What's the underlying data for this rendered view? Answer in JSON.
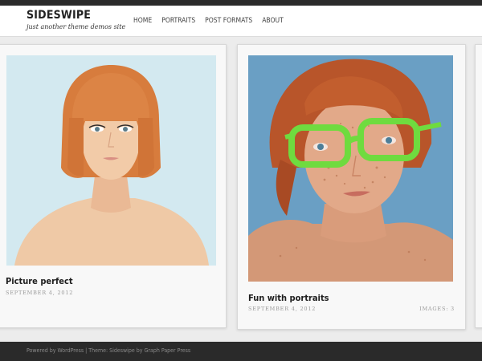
{
  "site": {
    "title": "SIDESWIPE",
    "tagline": "just another theme demos site"
  },
  "nav": {
    "items": [
      "HOME",
      "PORTRAITS",
      "POST FORMATS",
      "ABOUT"
    ]
  },
  "posts": [
    {
      "title": "Picture perfect",
      "date": "SEPTEMBER 4, 2012"
    },
    {
      "title": "Fun with portraits",
      "date": "SEPTEMBER 4, 2012",
      "images": "IMAGES: 3"
    }
  ],
  "footer": {
    "powered": "Powered by WordPress",
    "separator": "|",
    "theme": "Theme: Sideswipe by Graph Paper Press"
  },
  "colors": {
    "topbar": "#2b2b2b",
    "footer": "#2a2a2a",
    "background": "#ececec"
  }
}
